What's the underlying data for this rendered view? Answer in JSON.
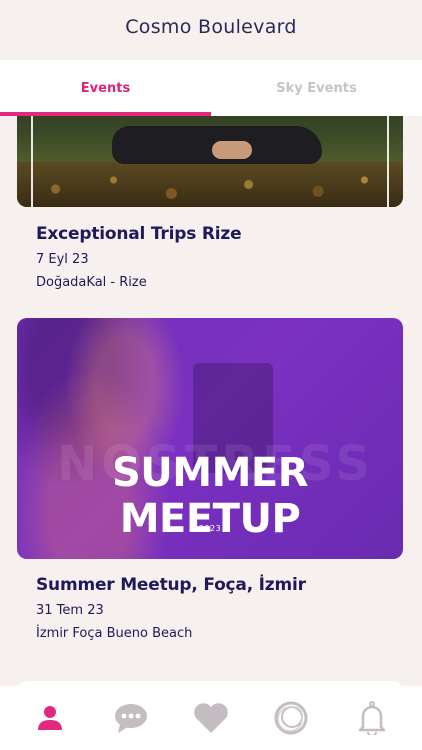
{
  "header": {
    "title": "Cosmo Boulevard"
  },
  "tabs": [
    {
      "label": "Events",
      "active": true
    },
    {
      "label": "Sky Events",
      "active": false
    }
  ],
  "events": [
    {
      "title": "Exceptional Trips Rize",
      "date": "7 Eyl 23",
      "location": "DoğadaKal - Rize"
    },
    {
      "title": "Summer Meetup, Foça, İzmir",
      "date": "31 Tem 23",
      "location": "İzmir Foça Bueno Beach",
      "banner": {
        "headline": "SUMMER MEETUP",
        "year": "2023",
        "background_word": "NOSTRESS"
      }
    }
  ],
  "bottom_nav": [
    {
      "icon": "profile-icon",
      "active": true
    },
    {
      "icon": "chat-icon",
      "active": false
    },
    {
      "icon": "heart-icon",
      "active": false
    },
    {
      "icon": "circle-logo-icon",
      "active": false
    },
    {
      "icon": "bell-icon",
      "active": false
    }
  ],
  "colors": {
    "accent": "#e2287f",
    "title_text": "#1f1b5a",
    "banner_purple": "#7b30c2",
    "nav_inactive": "#c4bec2"
  }
}
